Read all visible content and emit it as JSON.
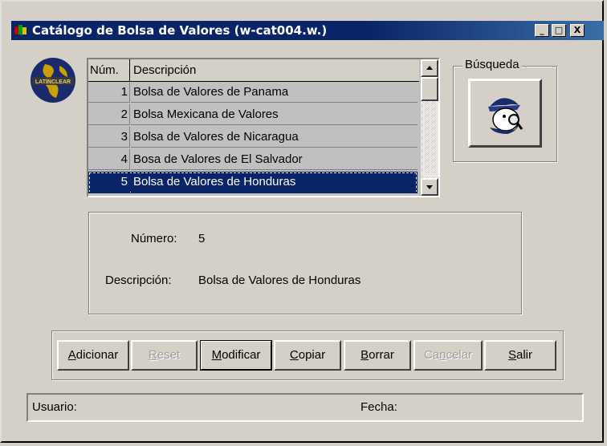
{
  "window": {
    "title": "Catálogo de Bolsa de Valores (w-cat004.w.)",
    "minimize": "_",
    "maximize": "□",
    "close": "X"
  },
  "logo_text": "LATINCLEAR",
  "grid": {
    "headers": {
      "num": "Núm.",
      "desc": "Descripción"
    },
    "rows": [
      {
        "num": "1",
        "desc": "Bolsa de Valores de Panama"
      },
      {
        "num": "2",
        "desc": "Bolsa Mexicana de Valores"
      },
      {
        "num": "3",
        "desc": "Bolsa de Valores de Nicaragua"
      },
      {
        "num": "4",
        "desc": "Bosa de Valores de El Salvador"
      },
      {
        "num": "5",
        "desc": "Bolsa de Valores de Honduras"
      }
    ],
    "selected_index": 4
  },
  "search": {
    "label": "Búsqueda"
  },
  "detail": {
    "numero_label": "Número:",
    "numero_value": "5",
    "descripcion_label": "Descripción:",
    "descripcion_value": "Bolsa de Valores de Honduras"
  },
  "buttons": {
    "adicionar": {
      "first": "A",
      "rest": "dicionar"
    },
    "reset": {
      "first": "R",
      "rest": "eset"
    },
    "modificar": {
      "first": "M",
      "rest": "odificar"
    },
    "copiar": {
      "first": "C",
      "rest": "opiar"
    },
    "borrar": {
      "first": "B",
      "rest": "orrar"
    },
    "cancelar": {
      "pre": "Ca",
      "u": "n",
      "rest": "celar"
    },
    "salir": {
      "first": "S",
      "rest": "alir"
    }
  },
  "status": {
    "usuario_label": "Usuario:",
    "fecha_label": "Fecha:"
  },
  "colors": {
    "titlebar": "#0a246a",
    "selection": "#0a246a",
    "face": "#d4d0c8"
  }
}
